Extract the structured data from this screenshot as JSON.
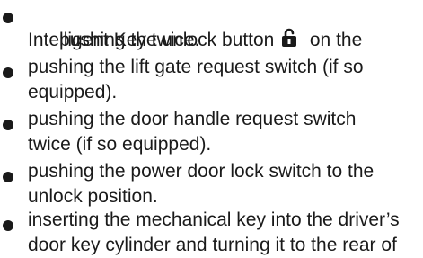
{
  "items": [
    {
      "line1_before": "pushing the unlock button ",
      "line1_after": "  on the",
      "line2": "Intelligent Key twice."
    },
    {
      "line1": "pushing the lift gate request switch (if so",
      "line2": "equipped)."
    },
    {
      "line1": "pushing the door handle request switch",
      "line2": "twice (if so equipped)."
    },
    {
      "line1": "pushing the power door lock switch to the",
      "line2": "unlock position."
    },
    {
      "line1": "inserting the mechanical key into the driver’s",
      "line2": "door key cylinder and turning it to the rear of"
    }
  ],
  "icons": {
    "unlock": "unlock-padlock-icon"
  }
}
